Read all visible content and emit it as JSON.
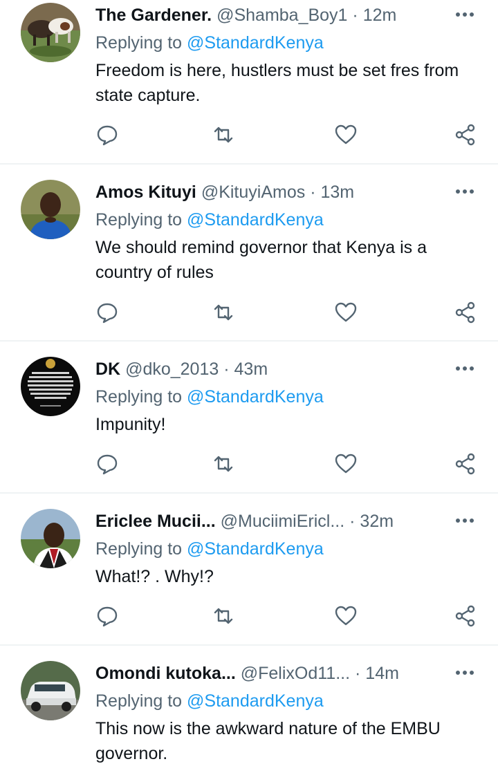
{
  "colors": {
    "text": "#0f1419",
    "secondary": "#536471",
    "link": "#1d9bf0",
    "divider": "#eff3f4"
  },
  "replying_label": "Replying to",
  "tweets": [
    {
      "name": "The Gardener.",
      "handle": "@Shamba_Boy1",
      "separator": "·",
      "time": "12m",
      "mention": "@StandardKenya",
      "text": "Freedom is here, hustlers must be set fres from state capture.",
      "avatar": "cattle-photo"
    },
    {
      "name": "Amos Kituyi",
      "handle": "@KituyiAmos",
      "separator": "·",
      "time": "13m",
      "mention": "@StandardKenya",
      "text": "We should remind governor that Kenya is a country of rules",
      "avatar": "person-photo"
    },
    {
      "name": "DK",
      "handle": "@dko_2013",
      "separator": "·",
      "time": "43m",
      "mention": "@StandardKenya",
      "text": "Impunity!",
      "avatar": "quote-image"
    },
    {
      "name": "Ericlee Mucii...",
      "handle": "@MuciimiEricl...",
      "separator": "·",
      "time": "32m",
      "mention": "@StandardKenya",
      "text": "What!? . Why!?",
      "avatar": "person-photo"
    },
    {
      "name": "Omondi kutoka...",
      "handle": "@FelixOd11...",
      "separator": "·",
      "time": "14m",
      "mention": "@StandardKenya",
      "text": "This now is the awkward nature of the EMBU governor.",
      "avatar": "car-photo"
    }
  ]
}
